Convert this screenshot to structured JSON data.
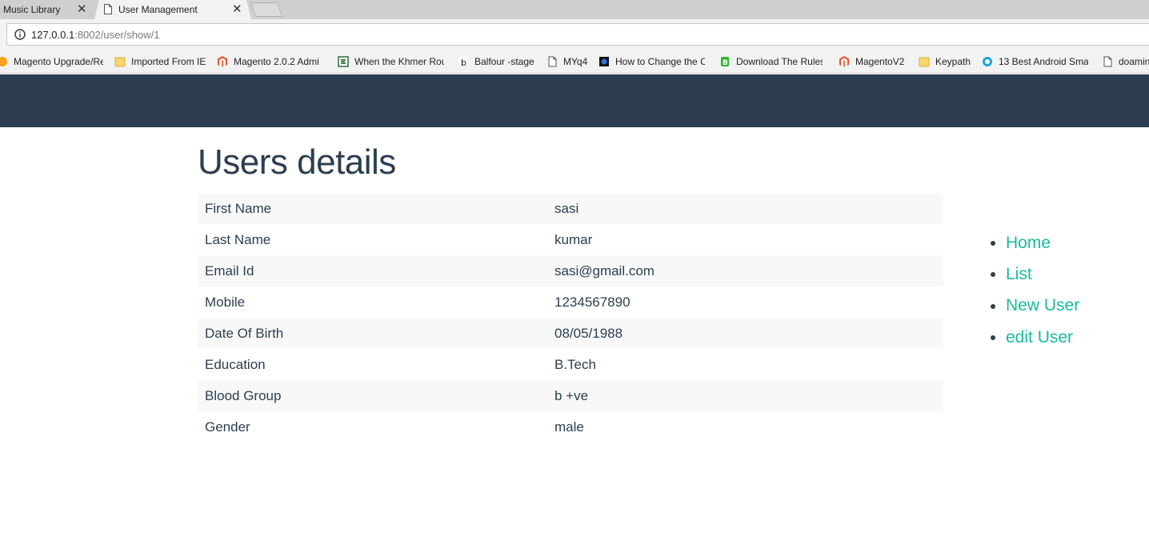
{
  "browser": {
    "tabs": [
      {
        "title": "Music Library",
        "active": false
      },
      {
        "title": "User Management",
        "active": true
      }
    ],
    "close_glyph": "✕",
    "url_host": "127.0.0.1",
    "url_rest": ":8002/user/show/1",
    "bookmarks": [
      {
        "label": "Magento Upgrade/Re",
        "icon": "magento-orange-icon"
      },
      {
        "label": "Imported From IE",
        "icon": "folder-icon"
      },
      {
        "label": "Magento 2.0.2  Admi",
        "icon": "magento-icon"
      },
      {
        "label": "When the Khmer Rou",
        "icon": "e-icon"
      },
      {
        "label": "Balfour -stage",
        "icon": "b-icon"
      },
      {
        "label": "MYq4",
        "icon": "page-icon"
      },
      {
        "label": "How to Change the C",
        "icon": "dark-square-icon"
      },
      {
        "label": "Download The Rules",
        "icon": "green-icon"
      },
      {
        "label": "MagentoV2",
        "icon": "magento-icon"
      },
      {
        "label": "Keypath",
        "icon": "folder-icon"
      },
      {
        "label": "13 Best Android Sma",
        "icon": "blue-circle-icon"
      },
      {
        "label": "doamin",
        "icon": "page-icon"
      }
    ]
  },
  "page": {
    "title": "Users details",
    "details": [
      {
        "label": "First Name",
        "value": "sasi"
      },
      {
        "label": "Last Name",
        "value": "kumar"
      },
      {
        "label": "Email Id",
        "value": "sasi@gmail.com"
      },
      {
        "label": "Mobile",
        "value": "1234567890"
      },
      {
        "label": "Date Of Birth",
        "value": "08/05/1988"
      },
      {
        "label": "Education",
        "value": "B.Tech"
      },
      {
        "label": "Blood Group",
        "value": "b +ve"
      },
      {
        "label": "Gender",
        "value": "male"
      }
    ],
    "nav": [
      {
        "label": "Home"
      },
      {
        "label": "List"
      },
      {
        "label": "New User"
      },
      {
        "label": "edit User"
      }
    ]
  },
  "colors": {
    "header_bg": "#2c3e50",
    "text": "#2c3e50",
    "link": "#18bc9c",
    "stripe": "#f8f8f8"
  }
}
